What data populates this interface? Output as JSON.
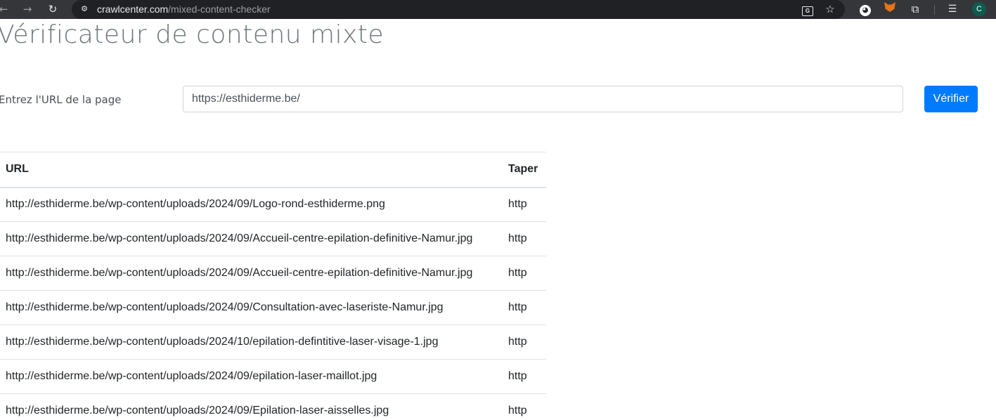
{
  "browser": {
    "url_host": "crawlcenter.com",
    "url_path": "/mixed-content-checker",
    "avatar_letter": "C"
  },
  "page": {
    "title": "Vérificateur de contenu mixte",
    "url_label": "Entrez l'URL de la page",
    "url_value": "https://esthiderme.be/",
    "check_button": "Vérifier"
  },
  "table": {
    "headers": {
      "url": "URL",
      "type": "Taper"
    },
    "rows": [
      {
        "url": "http://esthiderme.be/wp-content/uploads/2024/09/Logo-rond-esthiderme.png",
        "type": "http"
      },
      {
        "url": "http://esthiderme.be/wp-content/uploads/2024/09/Accueil-centre-epilation-definitive-Namur.jpg",
        "type": "http"
      },
      {
        "url": "http://esthiderme.be/wp-content/uploads/2024/09/Accueil-centre-epilation-definitive-Namur.jpg",
        "type": "http"
      },
      {
        "url": "http://esthiderme.be/wp-content/uploads/2024/09/Consultation-avec-laseriste-Namur.jpg",
        "type": "http"
      },
      {
        "url": "http://esthiderme.be/wp-content/uploads/2024/10/epilation-defintitive-laser-visage-1.jpg",
        "type": "http"
      },
      {
        "url": "http://esthiderme.be/wp-content/uploads/2024/09/epilation-laser-maillot.jpg",
        "type": "http"
      },
      {
        "url": "http://esthiderme.be/wp-content/uploads/2024/09/Epilation-laser-aisselles.jpg",
        "type": "http"
      }
    ]
  },
  "icons": {
    "back": "arrow-left-icon",
    "forward": "arrow-right-icon",
    "reload": "reload-icon",
    "site_info": "tune-icon",
    "translate": "translate-icon",
    "bookmark": "star-icon",
    "extensions": "puzzle-icon",
    "reading_list": "reading-list-icon"
  },
  "colors": {
    "primary_button": "#007bff",
    "title": "#6c757d",
    "chrome_bar": "#35363a"
  }
}
